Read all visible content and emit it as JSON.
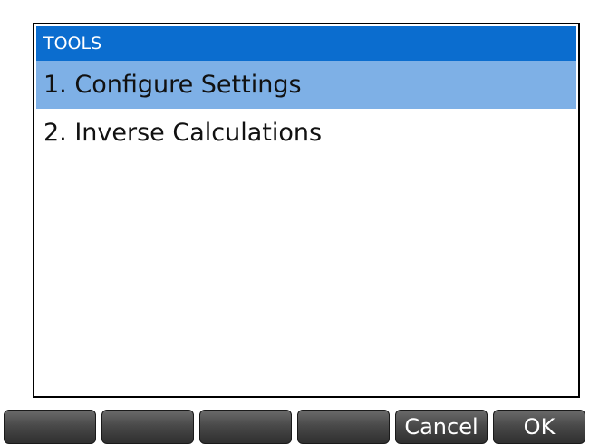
{
  "menu": {
    "title": "TOOLS",
    "items": [
      {
        "label": "1. Configure Settings",
        "selected": true
      },
      {
        "label": "2. Inverse Calculations",
        "selected": false
      }
    ],
    "colors": {
      "header_bg": "#0b6dcf",
      "selected_bg": "#7eb0e6"
    }
  },
  "softkeys": {
    "keys": [
      "",
      "",
      "",
      "",
      "Cancel",
      "OK"
    ]
  }
}
